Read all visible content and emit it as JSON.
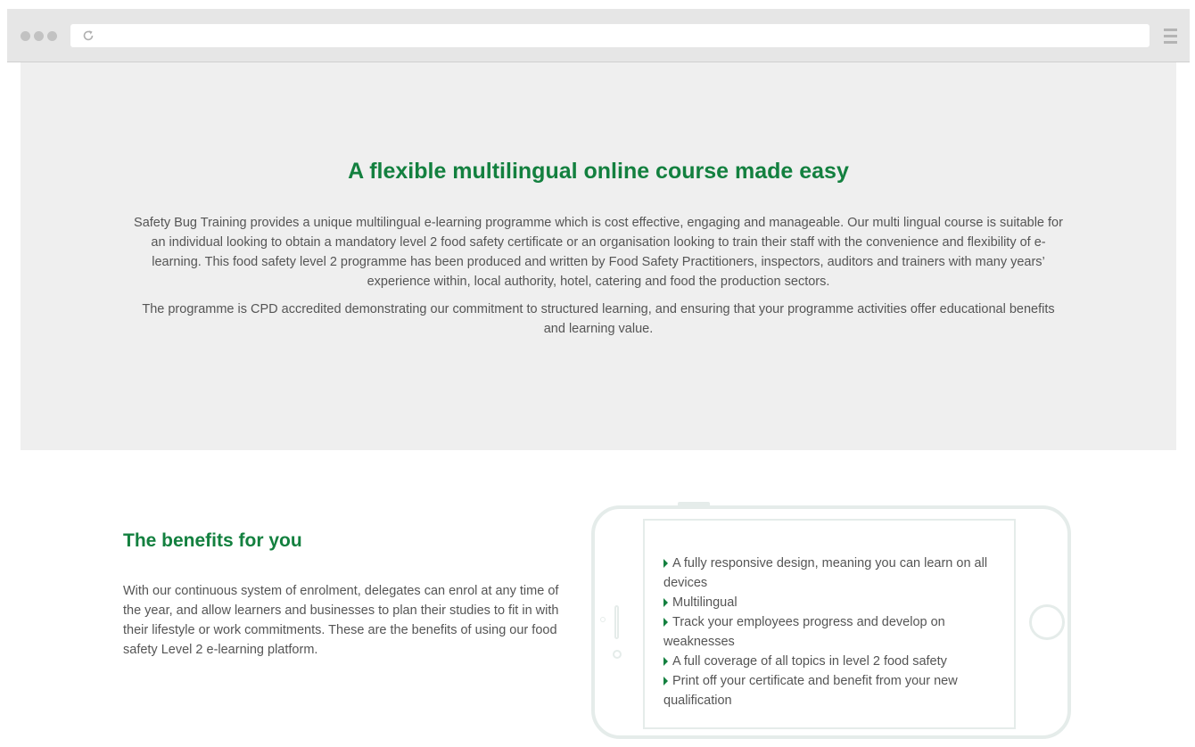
{
  "colors": {
    "accent": "#13803f",
    "body_text": "#555555",
    "hero_background": "#efefef",
    "chrome_background": "#e6e6e6"
  },
  "browser": {
    "url": "",
    "reload_icon": "reload-icon",
    "menu_icon": "hamburger-menu-icon"
  },
  "hero": {
    "title": "A flexible multilingual online course made easy",
    "paragraph_1": "Safety Bug Training provides a unique multilingual e-learning programme which is cost effective, engaging and manageable. Our multi lingual course is suitable for an individual looking to obtain a mandatory level 2 food safety certificate or an organisation looking to train their staff with the convenience and flexibility of e-learning. This food safety level 2 programme has been produced and written by Food Safety Practitioners, inspectors, auditors and trainers with many years’ experience within, local authority, hotel, catering and food the production sectors.",
    "paragraph_2": "The programme is CPD accredited demonstrating our commitment to structured learning, and ensuring that your programme activities offer educational benefits and learning value."
  },
  "benefits": {
    "title": "The benefits for you",
    "text": "With our continuous system of enrolment, delegates can enrol at any time of the year, and allow learners and businesses to plan their studies to fit in with their lifestyle or work commitments. These are the benefits of using our food safety Level 2 e-learning platform.",
    "features": [
      "A fully responsive design, meaning you can learn on all devices",
      "Multilingual",
      "Track your employees progress and develop on weaknesses",
      "A full coverage of all topics in level 2 food safety",
      "Print off your certificate and benefit from your new qualification"
    ]
  }
}
